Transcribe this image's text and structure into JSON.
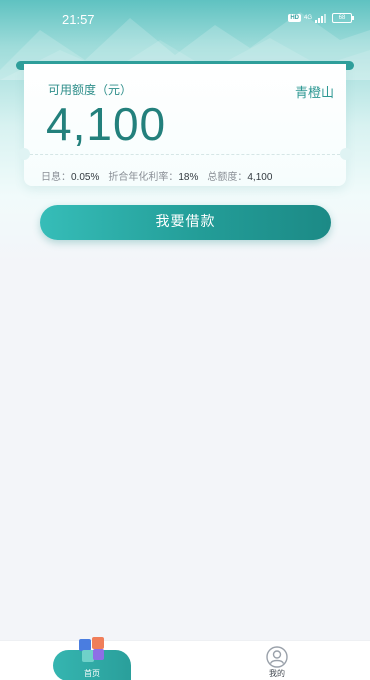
{
  "status_bar": {
    "time": "21:57",
    "hd_badge": "HD",
    "network": "4G",
    "battery": "68"
  },
  "credit_card": {
    "label": "可用额度（元）",
    "lender": "青橙山",
    "amount": "4,100",
    "rates": [
      {
        "label": "日息：",
        "value": "0.05%"
      },
      {
        "label": "折合年化利率：",
        "value": "18%"
      },
      {
        "label": "总额度：",
        "value": "4,100"
      }
    ]
  },
  "borrow_button": {
    "label": "我要借款"
  },
  "tab_bar": {
    "items": [
      {
        "label": "首页",
        "icon": "home-cube-icon",
        "active": true
      },
      {
        "label": "我的",
        "icon": "user-profile-icon",
        "active": false
      }
    ]
  },
  "colors": {
    "accent": "#239d98",
    "amount_text": "#23807c",
    "background": "#f3f5f9"
  }
}
